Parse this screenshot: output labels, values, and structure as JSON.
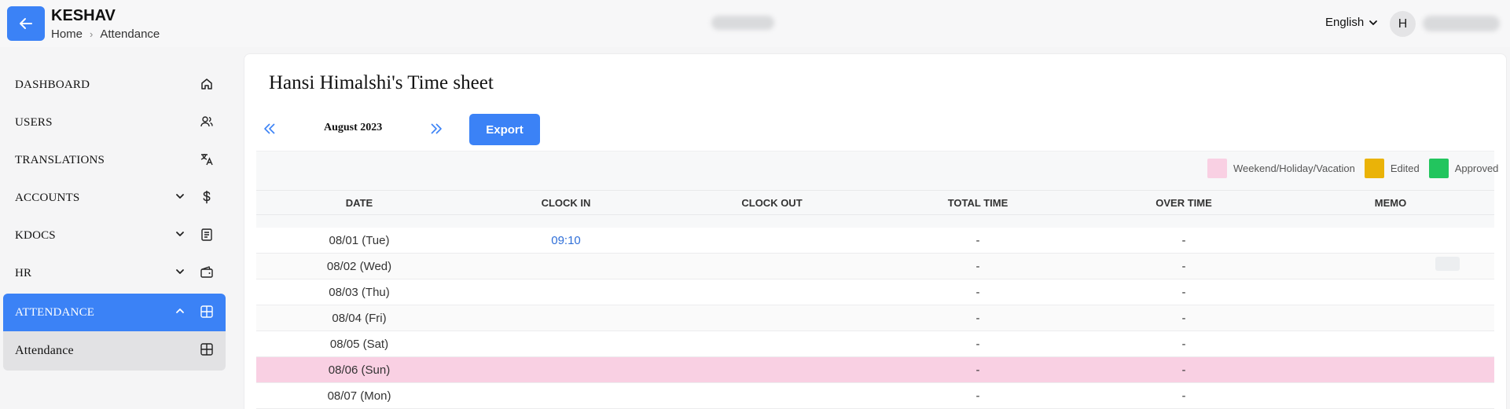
{
  "header": {
    "app_name": "KESHAV",
    "breadcrumb": [
      "Home",
      "Attendance"
    ],
    "language": "English",
    "avatar_initial": "H"
  },
  "sidebar": {
    "items": [
      {
        "label": "DASHBOARD",
        "icon": "home-icon",
        "expandable": false
      },
      {
        "label": "USERS",
        "icon": "users-icon",
        "expandable": false
      },
      {
        "label": "TRANSLATIONS",
        "icon": "translate-icon",
        "expandable": false
      },
      {
        "label": "ACCOUNTS",
        "icon": "dollar-icon",
        "expandable": true
      },
      {
        "label": "KDOCS",
        "icon": "document-icon",
        "expandable": true
      },
      {
        "label": "HR",
        "icon": "wallet-icon",
        "expandable": true
      },
      {
        "label": "ATTENDANCE",
        "icon": "grid-icon",
        "expandable": true,
        "active": true
      }
    ],
    "sub_items": [
      {
        "label": "Attendance",
        "icon": "grid-icon"
      }
    ]
  },
  "main": {
    "title": "Hansi Himalshi's Time sheet",
    "month": "August 2023",
    "export_label": "Export",
    "legend": [
      {
        "label": "Weekend/Holiday/Vacation",
        "color": "#f9d0e3"
      },
      {
        "label": "Edited",
        "color": "#eab308"
      },
      {
        "label": "Approved",
        "color": "#22c55e"
      }
    ],
    "columns": [
      "DATE",
      "CLOCK IN",
      "CLOCK OUT",
      "TOTAL TIME",
      "OVER TIME",
      "MEMO"
    ],
    "rows": [
      {
        "date": "08/01 (Tue)",
        "clock_in": "09:10",
        "clock_out": "",
        "total": "-",
        "over": "-",
        "memo": ""
      },
      {
        "date": "08/02 (Wed)",
        "clock_in": "",
        "clock_out": "",
        "total": "-",
        "over": "-",
        "memo": ""
      },
      {
        "date": "08/03 (Thu)",
        "clock_in": "",
        "clock_out": "",
        "total": "-",
        "over": "-",
        "memo": ""
      },
      {
        "date": "08/04 (Fri)",
        "clock_in": "",
        "clock_out": "",
        "total": "-",
        "over": "-",
        "memo": ""
      },
      {
        "date": "08/05 (Sat)",
        "clock_in": "",
        "clock_out": "",
        "total": "-",
        "over": "-",
        "memo": ""
      },
      {
        "date": "08/06 (Sun)",
        "clock_in": "",
        "clock_out": "",
        "total": "-",
        "over": "-",
        "memo": "",
        "weekend": true
      },
      {
        "date": "08/07 (Mon)",
        "clock_in": "",
        "clock_out": "",
        "total": "-",
        "over": "-",
        "memo": ""
      }
    ]
  },
  "colors": {
    "accent": "#3b82f6",
    "weekend": "#f9d0e3",
    "edited": "#eab308",
    "approved": "#22c55e"
  }
}
